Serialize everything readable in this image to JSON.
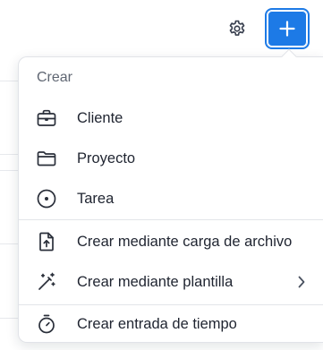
{
  "header": {
    "settings_icon": "gear-icon",
    "add_icon": "plus-icon",
    "accent_color": "#1d7ae6"
  },
  "menu": {
    "title": "Crear",
    "items": [
      {
        "label": "Cliente",
        "icon": "briefcase-icon"
      },
      {
        "label": "Proyecto",
        "icon": "folder-icon"
      },
      {
        "label": "Tarea",
        "icon": "task-circle-icon"
      },
      {
        "label": "Crear mediante carga de archivo",
        "icon": "file-upload-icon"
      },
      {
        "label": "Crear mediante plantilla",
        "icon": "magic-wand-icon",
        "has_submenu": true
      },
      {
        "label": "Crear entrada de tiempo",
        "icon": "stopwatch-icon"
      }
    ]
  }
}
